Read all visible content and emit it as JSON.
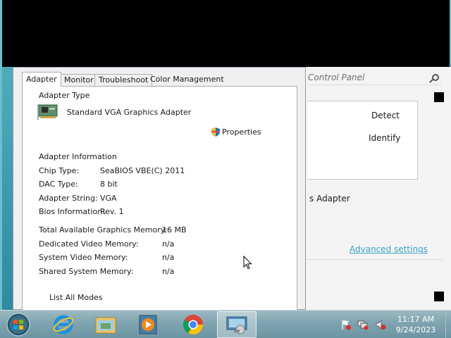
{
  "control_panel": {
    "search_placeholder": "Control Panel",
    "detect_label": "Detect",
    "identify_label": "Identify",
    "adapter_text": "s Adapter",
    "advanced_label": "Advanced settings"
  },
  "dialog": {
    "tabs": [
      {
        "label": "Adapter"
      },
      {
        "label": "Monitor"
      },
      {
        "label": "Troubleshoot"
      },
      {
        "label": "Color Management"
      }
    ],
    "adapter_type_heading": "Adapter Type",
    "adapter_name": "Standard VGA Graphics Adapter",
    "properties_label": "Properties",
    "info_heading": "Adapter Information",
    "info": [
      {
        "label": "Chip Type:",
        "value": "SeaBIOS VBE(C) 2011"
      },
      {
        "label": "DAC Type:",
        "value": "8 bit"
      },
      {
        "label": "Adapter String:",
        "value": "VGA"
      },
      {
        "label": "Bios Information:",
        "value": "Rev. 1"
      }
    ],
    "memory": [
      {
        "label": "Total Available Graphics Memory:",
        "value": "16 MB"
      },
      {
        "label": "Dedicated Video Memory:",
        "value": "n/a"
      },
      {
        "label": "System Video Memory:",
        "value": "n/a"
      },
      {
        "label": "Shared System Memory:",
        "value": "n/a"
      }
    ],
    "list_modes_label": "List All Modes"
  },
  "taskbar": {
    "items": [
      {
        "name": "internet-explorer"
      },
      {
        "name": "file-explorer"
      },
      {
        "name": "media-player"
      },
      {
        "name": "chrome"
      },
      {
        "name": "display-settings"
      }
    ],
    "clock_time": "11:17 AM",
    "clock_date": "9/24/2023"
  },
  "colors": {
    "link": "#3aa3c4",
    "desktop": "#4a9fb0",
    "taskbar": "#7fa4b0"
  }
}
